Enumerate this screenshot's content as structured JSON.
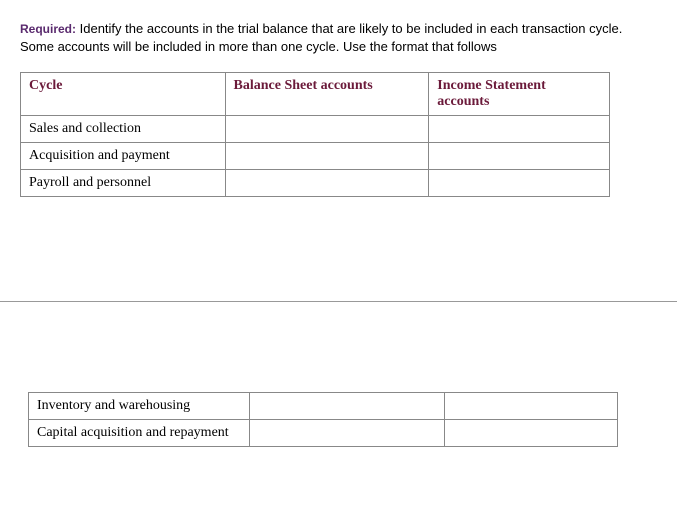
{
  "instructions": {
    "required_label": "Required:",
    "text": " Identify the accounts in the trial balance that are likely to be included in each transaction cycle. Some accounts will be included in more than one cycle. Use the format that follows"
  },
  "table1": {
    "headers": {
      "cycle": "Cycle",
      "balance_sheet": "Balance Sheet accounts",
      "income_statement": "Income Statement accounts"
    },
    "rows": [
      {
        "cycle": "Sales and collection",
        "bs": "",
        "is": ""
      },
      {
        "cycle": "Acquisition and payment",
        "bs": "",
        "is": ""
      },
      {
        "cycle": "Payroll and personnel",
        "bs": "",
        "is": ""
      }
    ]
  },
  "table2": {
    "rows": [
      {
        "cycle": "Inventory and warehousing",
        "bs": "",
        "is": ""
      },
      {
        "cycle": "Capital acquisition and repayment",
        "bs": "",
        "is": ""
      }
    ]
  }
}
